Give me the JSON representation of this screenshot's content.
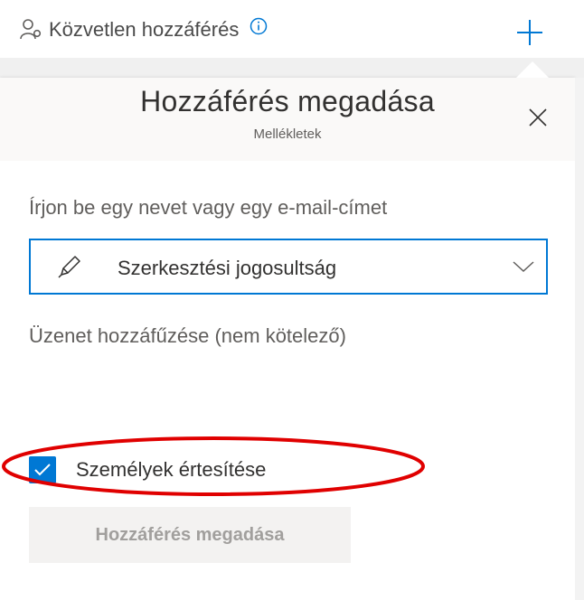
{
  "topbar": {
    "direct_access_label": "Közvetlen hozzáférés",
    "icons": {
      "people": "people-icon",
      "info": "info-icon",
      "add": "plus-icon"
    }
  },
  "panel": {
    "title": "Hozzáférés megadása",
    "subtitle": "Mellékletek",
    "name_input": {
      "placeholder": "Írjon be egy nevet vagy egy e-mail-címet",
      "value": ""
    },
    "permission": {
      "selected": "Szerkesztési jogosultság",
      "icon": "pencil-icon"
    },
    "message_input": {
      "placeholder": "Üzenet hozzáfűzése (nem kötelező)",
      "value": ""
    },
    "notify": {
      "label": "Személyek értesítése",
      "checked": true
    },
    "grant_button_label": "Hozzáférés megadása"
  },
  "colors": {
    "accent": "#0078d4",
    "highlight_ellipse": "#e00000",
    "disabled_button_bg": "#f3f2f1",
    "disabled_button_text": "#a19f9d"
  }
}
